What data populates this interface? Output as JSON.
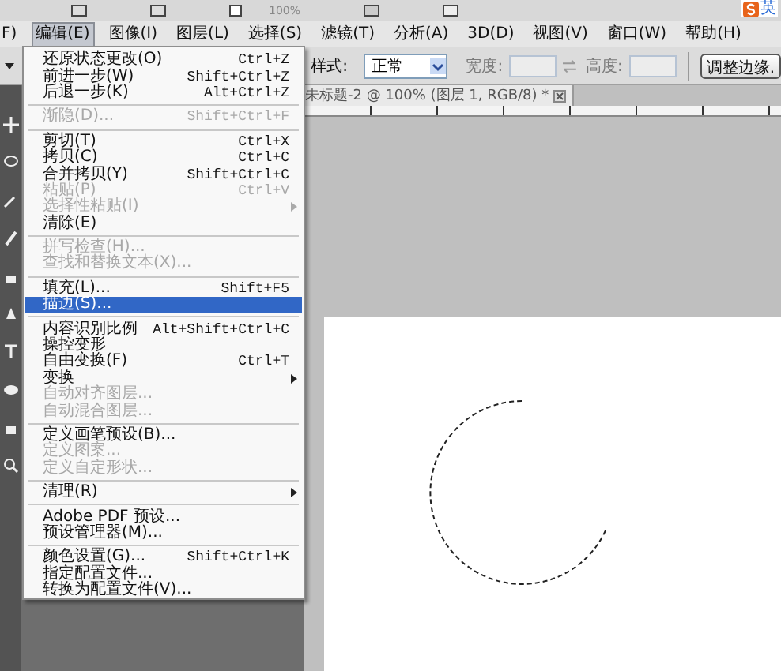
{
  "top_toolbar": {
    "zoom": "100%"
  },
  "ime": {
    "label": "英"
  },
  "menubar": [
    {
      "label": "F)",
      "selected": false
    },
    {
      "label": "编辑(E)",
      "selected": true
    },
    {
      "label": "图像(I)",
      "selected": false
    },
    {
      "label": "图层(L)",
      "selected": false
    },
    {
      "label": "选择(S)",
      "selected": false
    },
    {
      "label": "滤镜(T)",
      "selected": false
    },
    {
      "label": "分析(A)",
      "selected": false
    },
    {
      "label": "3D(D)",
      "selected": false
    },
    {
      "label": "视图(V)",
      "selected": false
    },
    {
      "label": "窗口(W)",
      "selected": false
    },
    {
      "label": "帮助(H)",
      "selected": false
    }
  ],
  "options_bar": {
    "style_label": "样式:",
    "style_value": "正常",
    "size_fields": [
      {
        "label": "宽度:",
        "disabled": true
      },
      {
        "label": "高度:",
        "disabled": true
      }
    ],
    "refine_button": "调整边缘."
  },
  "document_tab": {
    "title": "未标题-2 @ 100% (图层 1, RGB/8) *"
  },
  "menu": {
    "items": [
      {
        "kind": "item",
        "label": "还原状态更改(O)",
        "shortcut": "Ctrl+Z",
        "disabled": false,
        "selected": false,
        "submenu": false
      },
      {
        "kind": "item",
        "label": "前进一步(W)",
        "shortcut": "Shift+Ctrl+Z",
        "disabled": false,
        "selected": false,
        "submenu": false
      },
      {
        "kind": "item",
        "label": "后退一步(K)",
        "shortcut": "Alt+Ctrl+Z",
        "disabled": false,
        "selected": false,
        "submenu": false
      },
      {
        "kind": "separator"
      },
      {
        "kind": "item",
        "label": "渐隐(D)...",
        "shortcut": "Shift+Ctrl+F",
        "disabled": true,
        "selected": false,
        "submenu": false
      },
      {
        "kind": "separator"
      },
      {
        "kind": "item",
        "label": "剪切(T)",
        "shortcut": "Ctrl+X",
        "disabled": false,
        "selected": false,
        "submenu": false
      },
      {
        "kind": "item",
        "label": "拷贝(C)",
        "shortcut": "Ctrl+C",
        "disabled": false,
        "selected": false,
        "submenu": false
      },
      {
        "kind": "item",
        "label": "合并拷贝(Y)",
        "shortcut": "Shift+Ctrl+C",
        "disabled": false,
        "selected": false,
        "submenu": false
      },
      {
        "kind": "item",
        "label": "粘贴(P)",
        "shortcut": "Ctrl+V",
        "disabled": true,
        "selected": false,
        "submenu": false
      },
      {
        "kind": "item",
        "label": "选择性粘贴(I)",
        "disabled": true,
        "selected": false,
        "submenu": true
      },
      {
        "kind": "item",
        "label": "清除(E)",
        "disabled": false,
        "selected": false,
        "submenu": false
      },
      {
        "kind": "separator"
      },
      {
        "kind": "item",
        "label": "拼写检查(H)...",
        "disabled": true,
        "selected": false,
        "submenu": false
      },
      {
        "kind": "item",
        "label": "查找和替换文本(X)...",
        "disabled": true,
        "selected": false,
        "submenu": false
      },
      {
        "kind": "separator"
      },
      {
        "kind": "item",
        "label": "填充(L)...",
        "shortcut": "Shift+F5",
        "disabled": false,
        "selected": false,
        "submenu": false
      },
      {
        "kind": "item",
        "label": "描边(S)...",
        "disabled": false,
        "selected": true,
        "submenu": false
      },
      {
        "kind": "separator"
      },
      {
        "kind": "item",
        "label": "内容识别比例",
        "shortcut": "Alt+Shift+Ctrl+C",
        "disabled": false,
        "selected": false,
        "submenu": false
      },
      {
        "kind": "item",
        "label": "操控变形",
        "disabled": false,
        "selected": false,
        "submenu": false
      },
      {
        "kind": "item",
        "label": "自由变换(F)",
        "shortcut": "Ctrl+T",
        "disabled": false,
        "selected": false,
        "submenu": false
      },
      {
        "kind": "item",
        "label": "变换",
        "disabled": false,
        "selected": false,
        "submenu": true
      },
      {
        "kind": "item",
        "label": "自动对齐图层...",
        "disabled": true,
        "selected": false,
        "submenu": false
      },
      {
        "kind": "item",
        "label": "自动混合图层...",
        "disabled": true,
        "selected": false,
        "submenu": false
      },
      {
        "kind": "separator"
      },
      {
        "kind": "item",
        "label": "定义画笔预设(B)...",
        "disabled": false,
        "selected": false,
        "submenu": false
      },
      {
        "kind": "item",
        "label": "定义图案...",
        "disabled": true,
        "selected": false,
        "submenu": false
      },
      {
        "kind": "item",
        "label": "定义自定形状...",
        "disabled": true,
        "selected": false,
        "submenu": false
      },
      {
        "kind": "separator"
      },
      {
        "kind": "item",
        "label": "清理(R)",
        "disabled": false,
        "selected": false,
        "submenu": true
      },
      {
        "kind": "separator"
      },
      {
        "kind": "item",
        "label": "Adobe PDF 预设...",
        "disabled": false,
        "selected": false,
        "submenu": false
      },
      {
        "kind": "item",
        "label": "预设管理器(M)...",
        "disabled": false,
        "selected": false,
        "submenu": false
      },
      {
        "kind": "separator"
      },
      {
        "kind": "item",
        "label": "颜色设置(G)...",
        "shortcut": "Shift+Ctrl+K",
        "disabled": false,
        "selected": false,
        "submenu": false
      },
      {
        "kind": "item",
        "label": "指定配置文件...",
        "disabled": false,
        "selected": false,
        "submenu": false
      },
      {
        "kind": "item",
        "label": "转换为配置文件(V)...",
        "disabled": false,
        "selected": false,
        "submenu": false
      }
    ]
  }
}
